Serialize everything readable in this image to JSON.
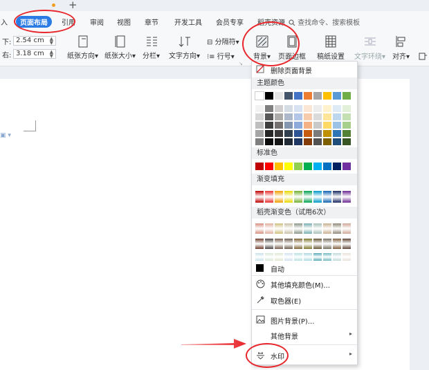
{
  "tabs": [
    {
      "label": "入",
      "active": false
    },
    {
      "label": "页面布局",
      "active": true
    },
    {
      "label": "引用",
      "active": false
    },
    {
      "label": "审阅",
      "active": false
    },
    {
      "label": "视图",
      "active": false
    },
    {
      "label": "章节",
      "active": false
    },
    {
      "label": "开发工具",
      "active": false
    },
    {
      "label": "会员专享",
      "active": false
    },
    {
      "label": "稻壳资源",
      "active": false
    }
  ],
  "search": {
    "label": "查找命令、搜索模板"
  },
  "margins": {
    "bottom_label": "下:",
    "bottom_value": "2.54 cm",
    "right_label": "右:",
    "right_value": "3.18 cm"
  },
  "ribbon": {
    "orientation": "纸张方向",
    "size": "纸张大小",
    "columns": "分栏",
    "text_direction": "文字方向",
    "breaks": "分隔符",
    "line_numbers": "行号",
    "background": "背景",
    "page_border": "页面边框",
    "paper_setup": "稿纸设置",
    "text_wrap": "文字环绕",
    "align": "对齐"
  },
  "menu": {
    "remove_bg": "删除页面背景",
    "theme_colors": "主题颜色",
    "standard_colors": "标准色",
    "gradient_fill": "渐变填充",
    "docer_gradient": "稻壳渐变色（试用6次）",
    "auto": "自动",
    "more_fill": "其他填充颜色(M)...",
    "eyedropper": "取色器(E)",
    "picture_bg": "图片背景(P)...",
    "other_bg": "其他背景",
    "watermark": "水印"
  },
  "colors": {
    "theme_top": [
      "#ffffff",
      "#000000",
      "#e7e6e6",
      "#44546a",
      "#4472c4",
      "#ed7d31",
      "#a5a5a5",
      "#ffc000",
      "#5b9bd5",
      "#70ad47"
    ],
    "theme_shades": [
      [
        "#f2f2f2",
        "#7f7f7f",
        "#d0cece",
        "#d6dce4",
        "#d9e2f3",
        "#fbe5d5",
        "#ededed",
        "#fff2cc",
        "#deebf6",
        "#e2efd9"
      ],
      [
        "#d8d8d8",
        "#595959",
        "#aeabab",
        "#adb9ca",
        "#b4c6e7",
        "#f7cbac",
        "#dbdbdb",
        "#fee599",
        "#bdd7ee",
        "#c5e0b3"
      ],
      [
        "#bfbfbf",
        "#3f3f3f",
        "#757070",
        "#8496b0",
        "#8eaadb",
        "#f4b183",
        "#c9c9c9",
        "#ffd965",
        "#9cc3e5",
        "#a8d08d"
      ],
      [
        "#a5a5a5",
        "#262626",
        "#3a3838",
        "#323f4f",
        "#2f5496",
        "#c55a11",
        "#7b7b7b",
        "#bf9000",
        "#2e75b5",
        "#538135"
      ],
      [
        "#7f7f7f",
        "#0c0c0c",
        "#171616",
        "#222a35",
        "#1f3864",
        "#833c0b",
        "#525252",
        "#7f6000",
        "#1e4e79",
        "#375623"
      ]
    ],
    "standard": [
      "#c00000",
      "#ff0000",
      "#ffc000",
      "#ffff00",
      "#92d050",
      "#00b050",
      "#00b0f0",
      "#0070c0",
      "#002060",
      "#7030a0"
    ],
    "gradient": [
      "#c00000",
      "#e83030",
      "#f0a000",
      "#e8d800",
      "#70b030",
      "#00a050",
      "#0098c8",
      "#1060b0",
      "#182860",
      "#6a2890"
    ],
    "docer_row1": [
      "#d89080",
      "#e0b0a0",
      "#d0c080",
      "#c8c0a8",
      "#8a9888",
      "#78b0b0",
      "#a8c0b8",
      "#c8b090",
      "#908878",
      "#d0a898"
    ],
    "docer_row2": [
      "#704030",
      "#504848",
      "#786050",
      "#706050",
      "#806838",
      "#807830",
      "#685838",
      "#787060",
      "#806040",
      "#604838"
    ],
    "docer_row3": [
      "#c8e0e8",
      "#d8e8d8",
      "#e0e8d0",
      "#d0e0f0",
      "#b8e0e0",
      "#a8d8e0",
      "#58a8b8",
      "#70b8c0",
      "#c0d8d8",
      "#e8e0d8"
    ]
  }
}
